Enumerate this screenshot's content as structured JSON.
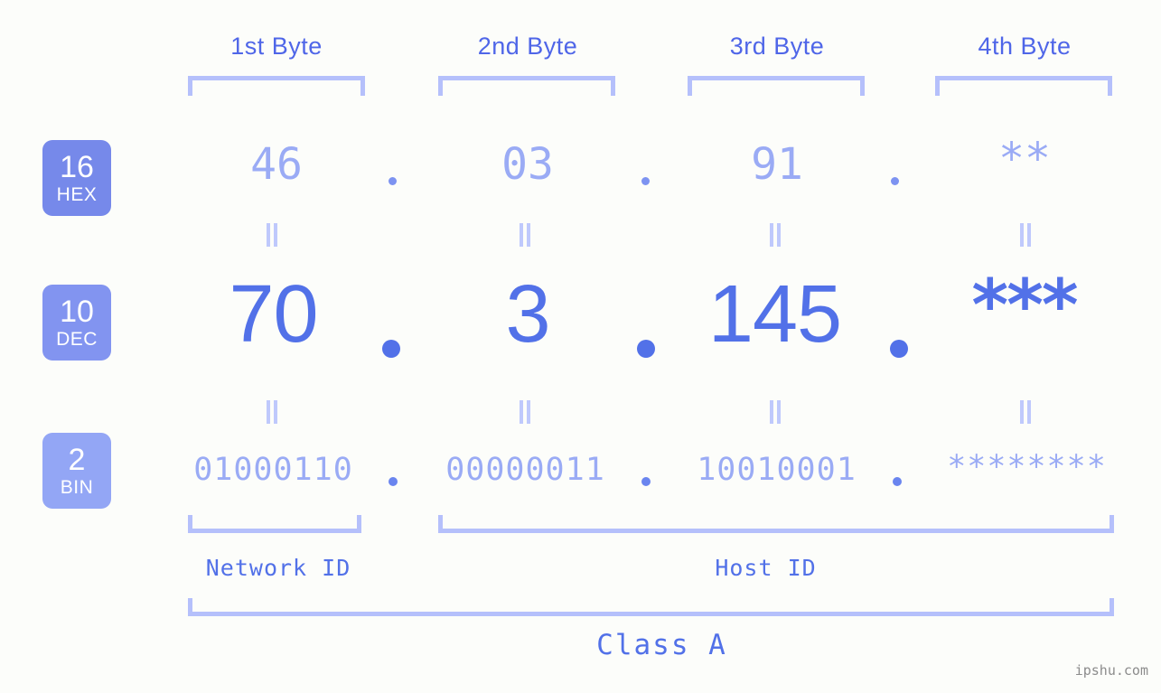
{
  "background_color": "#fcfdfa",
  "accent_color": "#5271e8",
  "light_accent_color": "#9aabf5",
  "bracket_color": "#b5c0fb",
  "byte_headers": [
    {
      "label": "1st Byte"
    },
    {
      "label": "2nd Byte"
    },
    {
      "label": "3rd Byte"
    },
    {
      "label": "4th Byte"
    }
  ],
  "rows": [
    {
      "base_number": "16",
      "base_name": "HEX",
      "badge_color": "#7689ea",
      "values": [
        "46",
        "03",
        "91",
        "**"
      ]
    },
    {
      "base_number": "10",
      "base_name": "DEC",
      "badge_color": "#8294f0",
      "values": [
        "70",
        "3",
        "145",
        "***"
      ]
    },
    {
      "base_number": "2",
      "base_name": "BIN",
      "badge_color": "#93a6f5",
      "values": [
        "01000110",
        "00000011",
        "10010001",
        "********"
      ]
    }
  ],
  "separators": {
    "dot": ".",
    "equals": "||"
  },
  "id_labels": {
    "network": "Network ID",
    "host": "Host ID"
  },
  "class_label": "Class A",
  "watermark": "ipshu.com"
}
